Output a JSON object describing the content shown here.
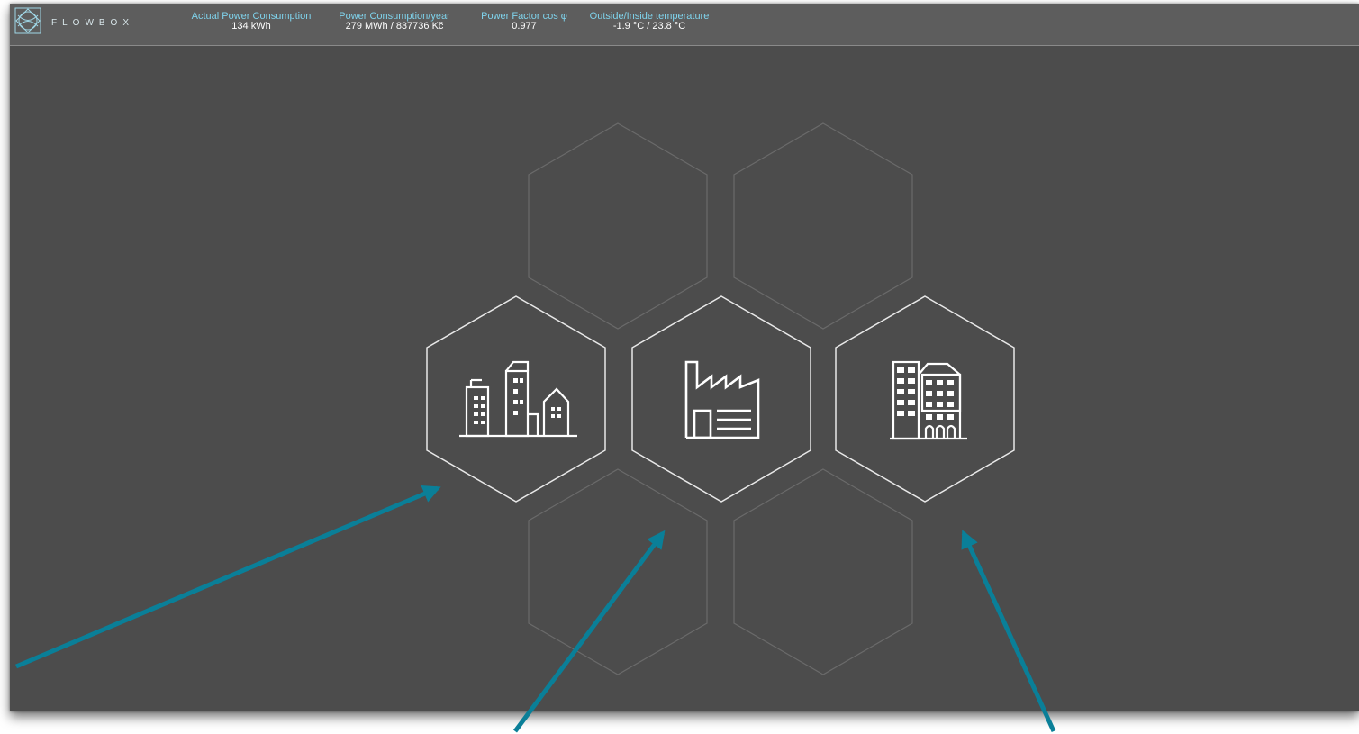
{
  "app": {
    "brand": "FLOWBOX",
    "accent_color": "#7fd3ec",
    "background_color": "#4c4c4c",
    "topbar_color": "#5d5d5d",
    "arrow_color": "#0a7f98"
  },
  "stats": [
    {
      "label": "Actual Power Consumption",
      "value": "134 kWh"
    },
    {
      "label": "Power Consumption/year",
      "value": "279 MWh / 837736 Kč"
    },
    {
      "label": "Power Factor cos φ",
      "value": "0.977"
    },
    {
      "label": "Outside/Inside temperature",
      "value": "-1.9 °C / 23.8 °C"
    }
  ],
  "tiles": {
    "active": [
      {
        "icon": "city-buildings-icon"
      },
      {
        "icon": "factory-icon"
      },
      {
        "icon": "office-building-icon"
      }
    ],
    "empty_count": 4
  }
}
